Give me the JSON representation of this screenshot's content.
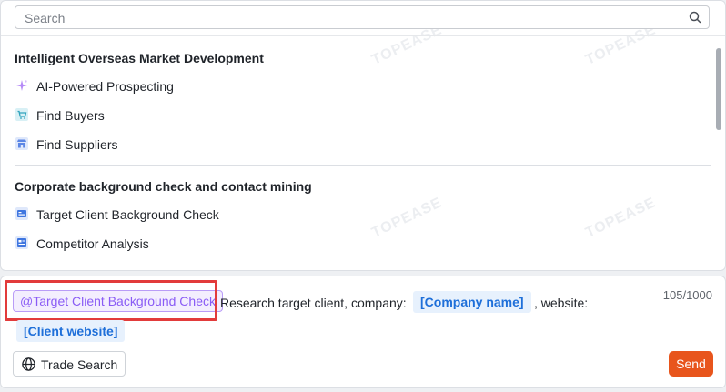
{
  "search": {
    "placeholder": "Search"
  },
  "watermark": "TOPEASE",
  "groups": [
    {
      "title": "Intelligent Overseas Market Development",
      "items": [
        {
          "label": "AI-Powered Prospecting",
          "icon": "sparkle-icon"
        },
        {
          "label": "Find Buyers",
          "icon": "cart-icon"
        },
        {
          "label": "Find Suppliers",
          "icon": "store-icon"
        }
      ]
    },
    {
      "title": "Corporate background check and contact mining",
      "items": [
        {
          "label": "Target Client Background Check",
          "icon": "id-card-icon"
        },
        {
          "label": "Competitor Analysis",
          "icon": "report-icon"
        }
      ]
    }
  ],
  "composer": {
    "mention": "@Target Client Background Check",
    "text_before": "Research target client, company:",
    "slot_company": "[Company name]",
    "text_middle": ", website:",
    "slot_website": "[Client website]",
    "counter": "105/1000",
    "trade_search_label": "Trade Search",
    "send_label": "Send"
  },
  "colors": {
    "accent": "#e8551c",
    "mention": "#8a5cf5",
    "slot": "#1e6fd9",
    "highlight": "#e23b3b"
  }
}
